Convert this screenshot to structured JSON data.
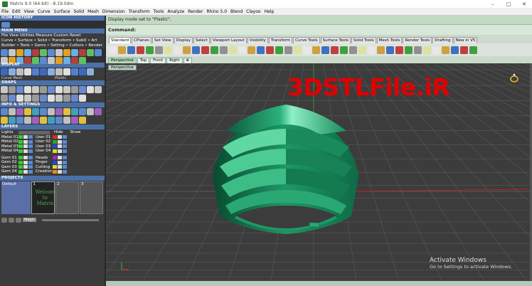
{
  "window": {
    "title": "Matrix 9.0 (64-bit) - 8.19.0dm",
    "logo_icon": "matrix-logo-icon"
  },
  "menubar": [
    "File",
    "Edit",
    "View",
    "Curve",
    "Surface",
    "Solid",
    "Mesh",
    "Dimension",
    "Transform",
    "Tools",
    "Analyze",
    "Render",
    "Rhino 5.0",
    "Blend",
    "Clayoo",
    "Help"
  ],
  "left_panel": {
    "icon_history": "ICON HISTORY",
    "main_menu": "MAIN MENU",
    "main_menu_rows": [
      "File  View  Utilities  Measure  Custom          Reset",
      "Curve • Surface • Solid • Transform • SubD • Art",
      "Builder • Tools • Gems • Setting • Cutters • Render"
    ],
    "display": "DISPLAY",
    "display_mode_left": "Curve Mesh",
    "display_mode_right": "Plastic",
    "snaps": "SNAPS",
    "info_settings": "INFO & SETTINGS",
    "layers": "LAYERS",
    "layers_lights": "Lights",
    "layers_hide": "Hide",
    "layers_show": "Show",
    "layer_rows": [
      {
        "left": "Metal 01",
        "right": "User 01",
        "lcolor": "#33cc33",
        "rcolor": "#ee2222"
      },
      {
        "left": "Metal 02",
        "right": "User 02",
        "lcolor": "#33cc33",
        "rcolor": "#22aa22"
      },
      {
        "left": "Metal 03",
        "right": "User 03",
        "lcolor": "#33cc33",
        "rcolor": "#2244ee"
      },
      {
        "left": "Metal 04",
        "right": "User 04",
        "lcolor": "#33cc33",
        "rcolor": "#dddd22"
      },
      {
        "left": "",
        "right": "",
        "lcolor": "",
        "rcolor": ""
      },
      {
        "left": "Gem 01",
        "right": "Heads",
        "lcolor": "#33cc33",
        "rcolor": "#aa22cc"
      },
      {
        "left": "Gem 02",
        "right": "Finger",
        "lcolor": "#33cc33",
        "rcolor": "#2244ee"
      },
      {
        "left": "Gem 03",
        "right": "Cutting",
        "lcolor": "#33cc33",
        "rcolor": "#dddd22"
      },
      {
        "left": "Gem 04",
        "right": "Creation",
        "lcolor": "#33cc33",
        "rcolor": "#ee8822"
      }
    ],
    "projects": "PROJECTS",
    "project_default": "Default",
    "project_cells": [
      "1",
      "2",
      "3"
    ],
    "welcome_text": "Welcome to Matrix",
    "bottom_label": "Magic"
  },
  "command": {
    "history_line": "Display mode set to \"Plastic\".",
    "prompt_label": "Command:"
  },
  "toolbar_tabs": [
    "Standard",
    "CPlanes",
    "Set View",
    "Display",
    "Select",
    "Viewport Layout",
    "Visibility",
    "Transform",
    "Curve Tools",
    "Surface Tools",
    "Solid Tools",
    "Mesh Tools",
    "Render Tools",
    "Drafting",
    "New in V5"
  ],
  "viewport_tabs": [
    "Perspective",
    "Top",
    "Front",
    "Right",
    "⊕"
  ],
  "viewport": {
    "label": "Perspective",
    "watermark": "3DSTLFile.iR",
    "activate_title": "Activate Windows",
    "activate_sub": "Go to Settings to activate Windows.",
    "ring_icon": "ring-icon"
  },
  "colors": {
    "panel_header": "#4a70a8",
    "command_bg": "#c4d9c4",
    "model": "#1f9a6a",
    "watermark": "#e10000"
  }
}
